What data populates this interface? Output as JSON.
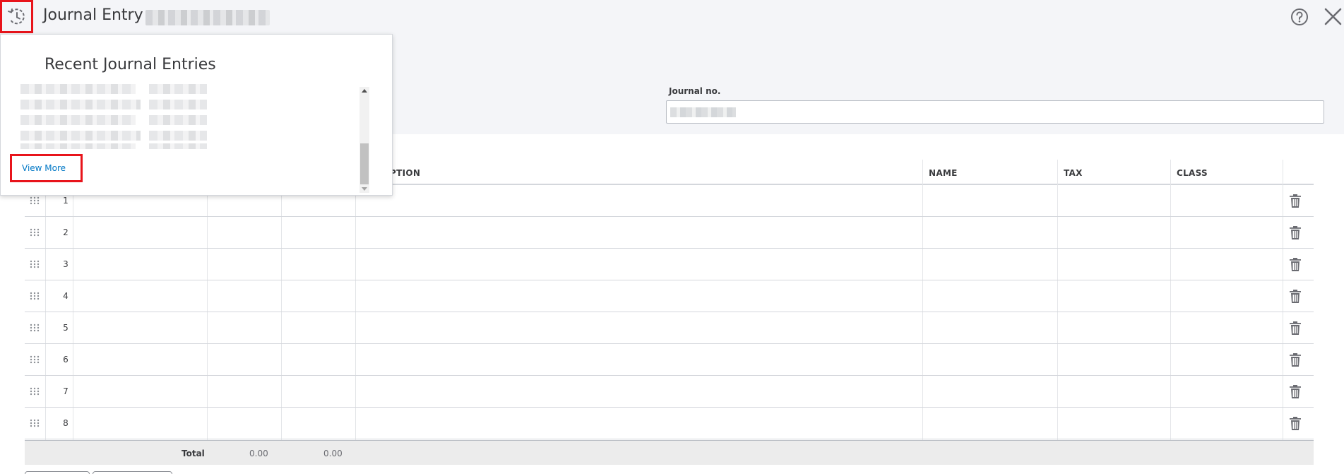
{
  "header": {
    "title": "Journal Entry",
    "journal_no_label": "Journal no."
  },
  "recent": {
    "title": "Recent Journal Entries",
    "view_more": "View More"
  },
  "table": {
    "headers": [
      "PTION",
      "NAME",
      "TAX",
      "CLASS"
    ],
    "rows": [
      "1",
      "2",
      "3",
      "4",
      "5",
      "6",
      "7",
      "8"
    ],
    "total_label": "Total",
    "total_debit": "0.00",
    "total_credit": "0.00"
  },
  "icons": {
    "history": "history-clock-icon",
    "help": "help-circle-icon",
    "close": "close-icon",
    "drag": "drag-handle-icon",
    "delete": "trash-icon"
  },
  "colors": {
    "highlight": "#e8141b",
    "link": "#0077c5",
    "header_bg": "#f4f5f8"
  }
}
